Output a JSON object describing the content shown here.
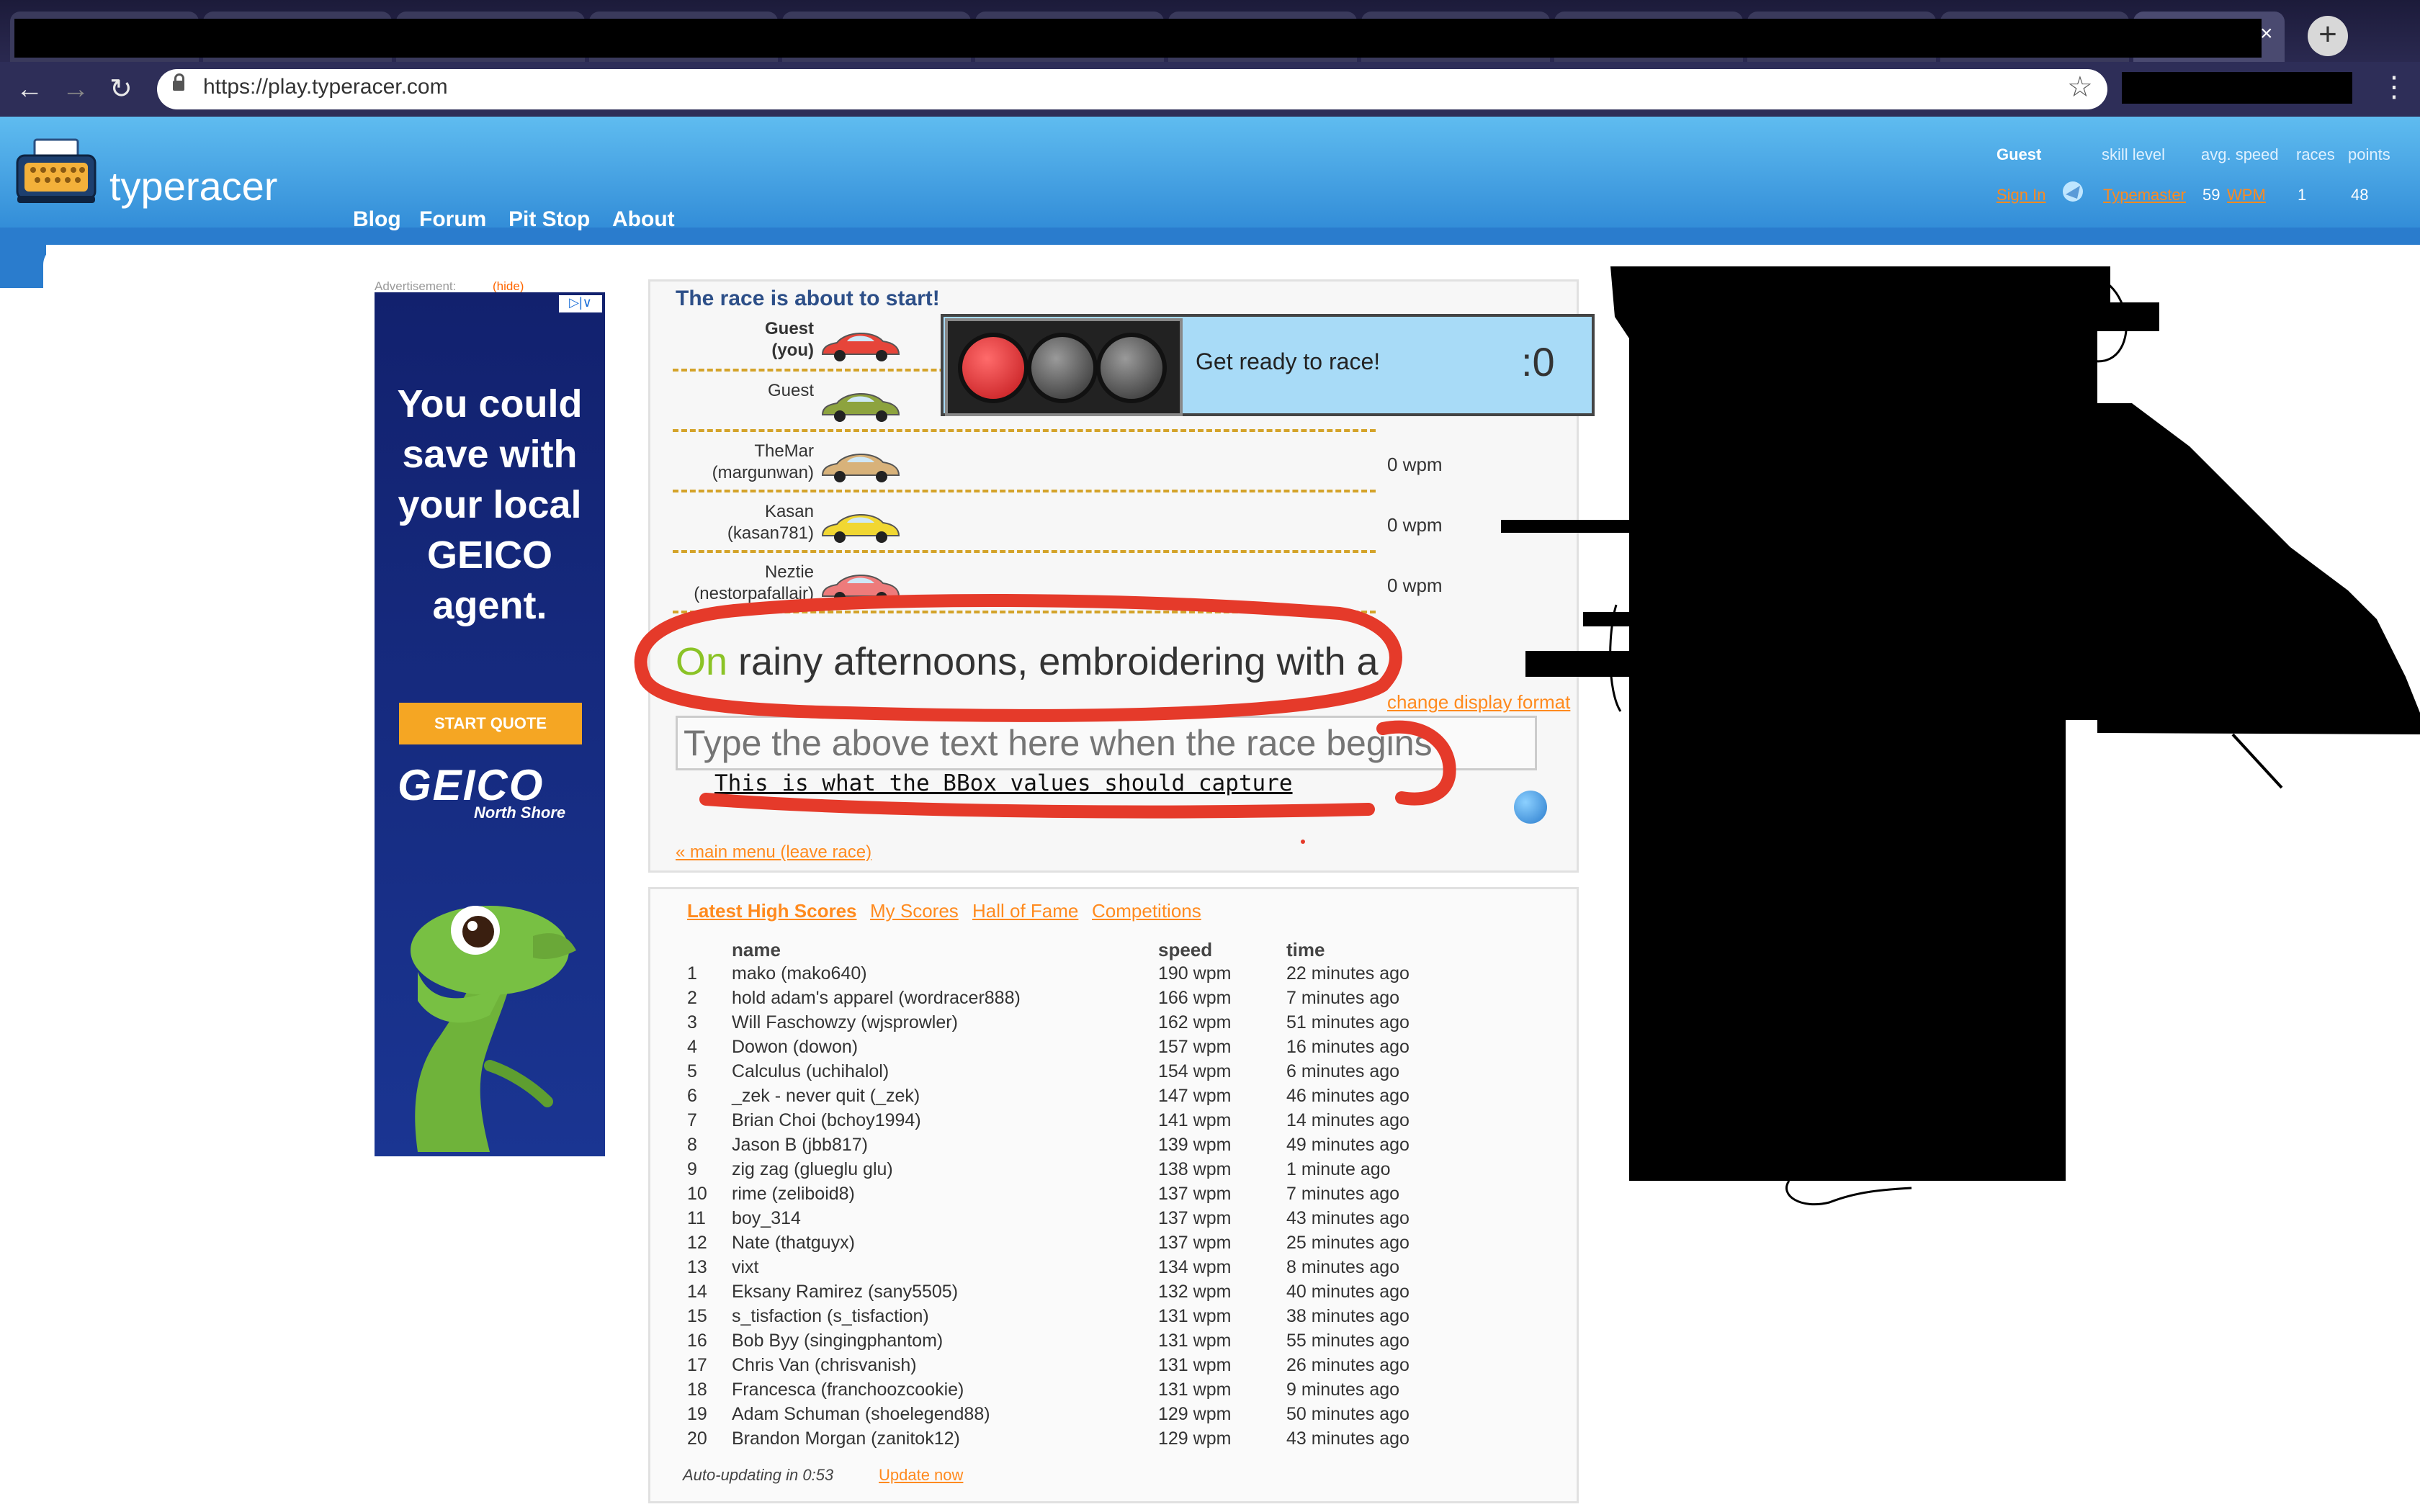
{
  "browser": {
    "url": "https://play.typeracer.com",
    "new_tab_icon": "+",
    "close_icon": "×"
  },
  "header": {
    "logo_text": "typeracer",
    "nav": [
      "Blog",
      "Forum",
      "Pit Stop",
      "About"
    ],
    "stats": {
      "headers": [
        "Guest",
        "skill level",
        "avg. speed",
        "races",
        "points"
      ],
      "sign_in": "Sign In",
      "skill": "Typemaster",
      "speed_value": "59",
      "speed_unit": "WPM",
      "races": "1",
      "points": "48"
    }
  },
  "ad": {
    "label": "Advertisement:",
    "hide": "(hide)",
    "headline": "You could save with your local GEICO agent.",
    "cta": "START QUOTE",
    "brand": "GEICO",
    "region": "North Shore"
  },
  "race": {
    "title": "The race is about to start!",
    "racers": [
      {
        "name": "Guest",
        "sub": "(you)",
        "wpm": "",
        "car_color": "#e6453a"
      },
      {
        "name": "Guest",
        "sub": "",
        "wpm": "",
        "car_color": "#8da33e"
      },
      {
        "name": "TheMar",
        "sub": "(margunwan)",
        "wpm": "0 wpm",
        "car_color": "#d8b27a"
      },
      {
        "name": "Kasan",
        "sub": "(kasan781)",
        "wpm": "0 wpm",
        "car_color": "#f1d732"
      },
      {
        "name": "Neztie",
        "sub": "(nestorpafallajr)",
        "wpm": "0 wpm",
        "car_color": "#ee7b7b"
      }
    ],
    "status": "Get ready to race!",
    "countdown": ":0",
    "text_first": "On",
    "text_rest": " rainy afternoons, embroidering with a",
    "display_format": "change display format",
    "input_placeholder": "Type the above text here when the race begins",
    "main_menu": "« main menu (leave race)"
  },
  "annotation": {
    "text": "This is what the BBox values should capture",
    "color": "#e53a2a"
  },
  "scores": {
    "tabs": [
      "Latest High Scores",
      "My Scores",
      "Hall of Fame",
      "Competitions"
    ],
    "columns": [
      "name",
      "speed",
      "time"
    ],
    "rows": [
      {
        "rank": "1",
        "name": "mako (mako640)",
        "speed": "190 wpm",
        "time": "22 minutes ago"
      },
      {
        "rank": "2",
        "name": "hold adam's apparel (wordracer888)",
        "speed": "166 wpm",
        "time": "7 minutes ago"
      },
      {
        "rank": "3",
        "name": "Will Faschowzy (wjsprowler)",
        "speed": "162 wpm",
        "time": "51 minutes ago"
      },
      {
        "rank": "4",
        "name": "Dowon (dowon)",
        "speed": "157 wpm",
        "time": "16 minutes ago"
      },
      {
        "rank": "5",
        "name": "Calculus (uchihalol)",
        "speed": "154 wpm",
        "time": "6 minutes ago"
      },
      {
        "rank": "6",
        "name": "_zek - never quit (_zek)",
        "speed": "147 wpm",
        "time": "46 minutes ago"
      },
      {
        "rank": "7",
        "name": "Brian Choi (bchoy1994)",
        "speed": "141 wpm",
        "time": "14 minutes ago"
      },
      {
        "rank": "8",
        "name": "Jason B (jbb817)",
        "speed": "139 wpm",
        "time": "49 minutes ago"
      },
      {
        "rank": "9",
        "name": "zig zag (glueglu glu)",
        "speed": "138 wpm",
        "time": "1 minute ago"
      },
      {
        "rank": "10",
        "name": "rime (zeliboid8)",
        "speed": "137 wpm",
        "time": "7 minutes ago"
      },
      {
        "rank": "11",
        "name": "boy_314",
        "speed": "137 wpm",
        "time": "43 minutes ago"
      },
      {
        "rank": "12",
        "name": "Nate (thatguyx)",
        "speed": "137 wpm",
        "time": "25 minutes ago"
      },
      {
        "rank": "13",
        "name": "vixt",
        "speed": "134 wpm",
        "time": "8 minutes ago"
      },
      {
        "rank": "14",
        "name": "Eksany Ramirez (sany5505)",
        "speed": "132 wpm",
        "time": "40 minutes ago"
      },
      {
        "rank": "15",
        "name": "s_tisfaction (s_tisfaction)",
        "speed": "131 wpm",
        "time": "38 minutes ago"
      },
      {
        "rank": "16",
        "name": "Bob Byy (singingphantom)",
        "speed": "131 wpm",
        "time": "55 minutes ago"
      },
      {
        "rank": "17",
        "name": "Chris Van (chrisvanish)",
        "speed": "131 wpm",
        "time": "26 minutes ago"
      },
      {
        "rank": "18",
        "name": "Francesca (franchoozcookie)",
        "speed": "131 wpm",
        "time": "9 minutes ago"
      },
      {
        "rank": "19",
        "name": "Adam Schuman (shoelegend88)",
        "speed": "129 wpm",
        "time": "50 minutes ago"
      },
      {
        "rank": "20",
        "name": "Brandon Morgan (zanitok12)",
        "speed": "129 wpm",
        "time": "43 minutes ago"
      }
    ],
    "auto_update": "Auto-updating in 0:53",
    "update_now": "Update now"
  }
}
